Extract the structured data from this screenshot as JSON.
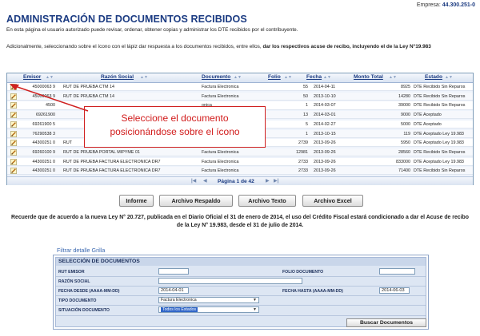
{
  "header": {
    "empresa_label": "Empresa:",
    "empresa_value": "44.300.251-0",
    "title": "ADMINISTRACIÓN DE DOCUMENTOS RECIBIDOS",
    "intro": "En esta página el usuario autorizado puede revisar, ordenar, obtener copias y administrar los DTE recibidos por el contribuyente.",
    "adicional_plain": "Adicionalmente, seleccionando sobre el ícono con el lápiz dar respuesta a los documentos recibidos, entre ellos, ",
    "adicional_bold": "dar los respectivos acuse de recibo, incluyendo el de la Ley N°19.983"
  },
  "grid": {
    "columns": [
      "Emisor",
      "Razón Social",
      "Documento",
      "Folio",
      "Fecha",
      "Monto Total",
      "Estado"
    ],
    "rows": [
      {
        "emisor": "45000063 9",
        "razon": "RUT DE PRUEBA CTM 14",
        "doc": "Factura Electronica",
        "folio": "55",
        "fecha": "2014-04-11",
        "monto": "8925",
        "estado": "DTE Recibido Sin Reparos"
      },
      {
        "emisor": "45000063 9",
        "razon": "RUT DE PRUEBA CTM 14",
        "doc": "Factura Electronica",
        "folio": "50",
        "fecha": "2013-10-10",
        "monto": "14280",
        "estado": "DTE Recibido Sin Reparos"
      },
      {
        "emisor": "4500",
        "razon": "",
        "doc": "onica",
        "folio": "1",
        "fecha": "2014-03-07",
        "monto": "39000",
        "estado": "DTE Recibido Sin Reparos"
      },
      {
        "emisor": "69261900",
        "razon": "",
        "doc": "onica",
        "folio": "13",
        "fecha": "2014-03-01",
        "monto": "9000",
        "estado": "DTE Aceptado"
      },
      {
        "emisor": "69261900 5",
        "razon": "",
        "doc": "onica",
        "folio": "5",
        "fecha": "2014-02-27",
        "monto": "5000",
        "estado": "DTE Aceptado"
      },
      {
        "emisor": "76290538 3",
        "razon": "",
        "doc": "",
        "folio": "1",
        "fecha": "2013-10-15",
        "monto": "119",
        "estado": "DTE Aceptado Ley 19.983"
      },
      {
        "emisor": "44300251 0",
        "razon": "RUT",
        "doc": "",
        "folio": "2739",
        "fecha": "2013-09-26",
        "monto": "5950",
        "estado": "DTE Aceptado Ley 19.983"
      },
      {
        "emisor": "69260100 9",
        "razon": "RUT DE PRUEBA PORTAL MIPYME 01",
        "doc": "Factura Electronica",
        "folio": "12981",
        "fecha": "2013-09-26",
        "monto": "28560",
        "estado": "DTE Recibido Sin Reparos"
      },
      {
        "emisor": "44300251 0",
        "razon": "RUT DE PRUEBA FACTURA ELECTRONICA DR7",
        "doc": "Factura Electronica",
        "folio": "2733",
        "fecha": "2013-09-26",
        "monto": "833000",
        "estado": "DTE Aceptado Ley 19.983"
      },
      {
        "emisor": "44300251 0",
        "razon": "RUT DE PRUEBA FACTURA ELECTRONICA DR7",
        "doc": "Factura Electronica",
        "folio": "2733",
        "fecha": "2013-09-26",
        "monto": "71400",
        "estado": "DTE Recibido Sin Reparos"
      }
    ],
    "pager": "Página 1 de 42",
    "pager_first": "|◀",
    "pager_prev": "◀",
    "pager_next": "▶",
    "pager_last": "▶|"
  },
  "callout": {
    "line1": "Seleccione el documento",
    "line2": "posicionándose sobre el ícono"
  },
  "buttons": {
    "informe": "Informe",
    "respaldo": "Archivo Respaldo",
    "texto": "Archivo Texto",
    "excel": "Archivo Excel"
  },
  "recuerde": "Recuerde que de acuerdo a la nueva Ley N° 20.727, publicada en el Diario Oficial el 31 de enero de 2014, el uso del Crédito Fiscal estará condicionado a dar el Acuse de recibo de la Ley N° 19.983, desde el 31 de julio de 2014.",
  "filter": {
    "link": "Filtrar detalle Grilla",
    "title": "SELECCIÓN DE DOCUMENTOS",
    "rut_emisor_label": "RUT EMISOR",
    "folio_label": "FOLIO DOCUMENTO",
    "razon_label": "RAZÓN SOCIAL",
    "fecha_desde_label": "FECHA DESDE (AAAA-MM-DD)",
    "fecha_desde_value": "2014-04-01",
    "fecha_hasta_label": "FECHA HASTA (AAAA-MM-DD)",
    "fecha_hasta_value": "2014-06-03",
    "tipo_label": "TIPO DOCUMENTO",
    "tipo_value": "Factura Electronica",
    "situacion_label": "SITUACIÓN DOCUMENTO",
    "situacion_value": "Todos los Estados",
    "search_button": "Buscar Documentos"
  },
  "colors": {
    "title_blue": "#1b3b82",
    "callout_red": "#d11a1a",
    "header_bg": "#d9e3f2"
  }
}
